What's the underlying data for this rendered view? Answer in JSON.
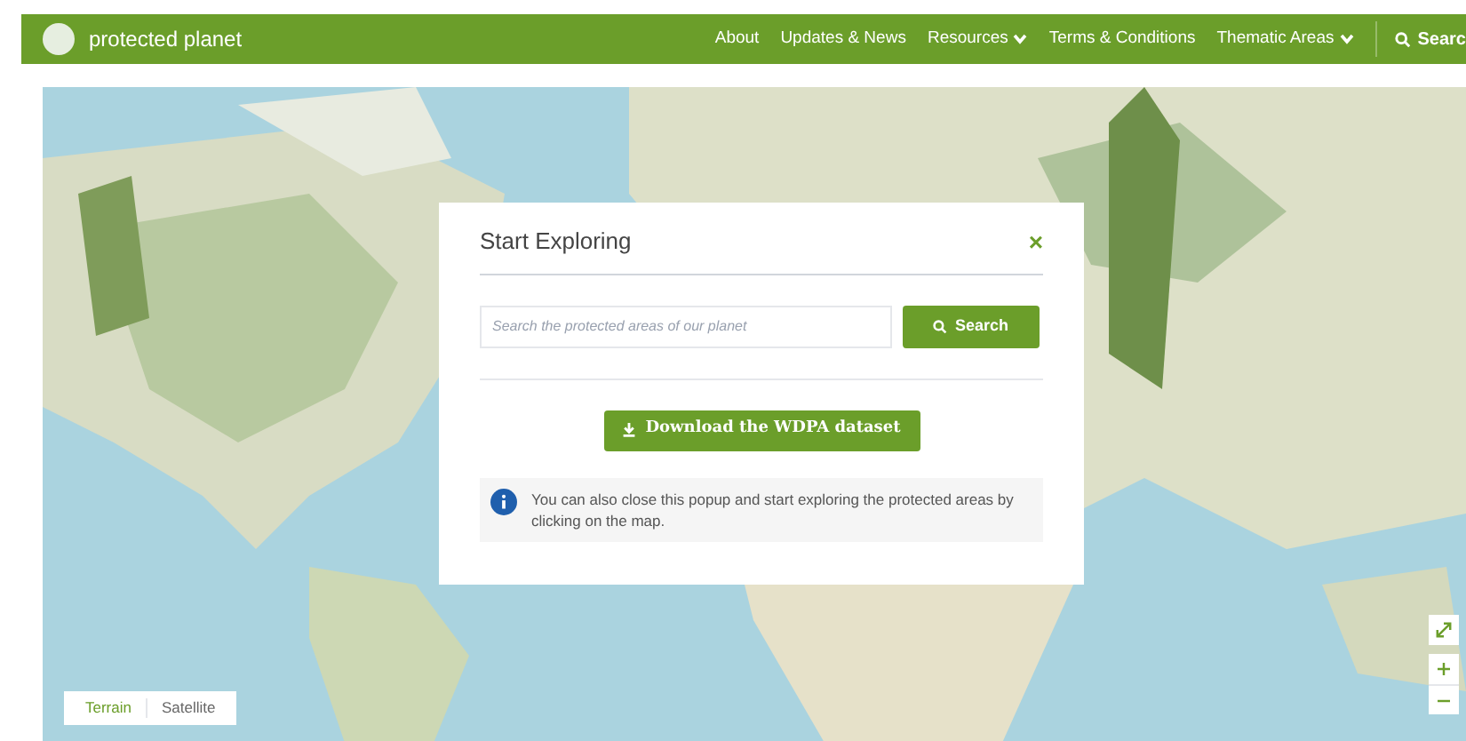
{
  "header": {
    "brand": "protected planet",
    "nav": [
      {
        "label": "About",
        "dropdown": false
      },
      {
        "label": "Updates & News",
        "dropdown": false
      },
      {
        "label": "Resources",
        "dropdown": true
      },
      {
        "label": "Terms & Conditions",
        "dropdown": false
      },
      {
        "label": "Thematic Areas",
        "dropdown": true
      }
    ],
    "search": "Searc"
  },
  "map": {
    "layers": [
      {
        "label": "Terrain",
        "selected": true
      },
      {
        "label": "Satellite",
        "selected": false
      }
    ]
  },
  "modal": {
    "title": "Start Exploring",
    "close": "×",
    "search": {
      "placeholder": "Search the protected areas of our planet",
      "button": "Search"
    },
    "download": "Download the WDPA dataset",
    "info": "You can also close this popup and start exploring the protected areas by clicking on the map."
  }
}
